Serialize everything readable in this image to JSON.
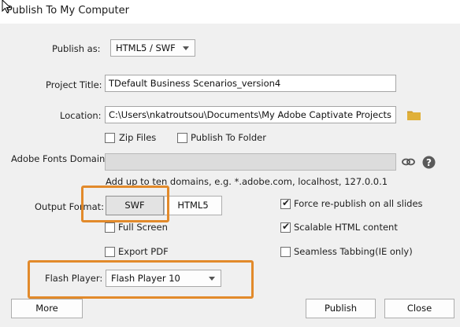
{
  "window": {
    "title": "Publish To My Computer"
  },
  "publish_as": {
    "label": "Publish as:",
    "value": "HTML5 / SWF"
  },
  "project_title": {
    "label": "Project Title:",
    "value": "TDefault Business Scenarios_version4"
  },
  "location": {
    "label": "Location:",
    "value": "C:\\Users\\nkatroutsou\\Documents\\My Adobe Captivate Projects"
  },
  "options": {
    "zip_files": "Zip Files",
    "publish_to_folder": "Publish To Folder"
  },
  "fonts": {
    "label": "Adobe Fonts Domains:",
    "value": "",
    "hint": "Add up to ten domains, e.g. *.adobe.com, localhost, 127.0.0.1"
  },
  "output_format": {
    "label": "Output Format:",
    "swf": "SWF",
    "html5": "HTML5",
    "selected": "SWF"
  },
  "checkboxes": {
    "full_screen": {
      "label": "Full Screen",
      "checked": false
    },
    "export_pdf": {
      "label": "Export PDF",
      "checked": false
    },
    "force_republish": {
      "label": "Force re-publish on all slides",
      "checked": true
    },
    "scalable_html": {
      "label": "Scalable HTML content",
      "checked": true
    },
    "seamless_tabbing": {
      "label": "Seamless Tabbing(IE only)",
      "checked": false
    }
  },
  "flash_player": {
    "label": "Flash Player:",
    "value": "Flash Player 10"
  },
  "buttons": {
    "more": "More",
    "publish": "Publish",
    "close": "Close"
  },
  "colors": {
    "highlight": "#e28a2b",
    "folder": "#e0b03a"
  }
}
